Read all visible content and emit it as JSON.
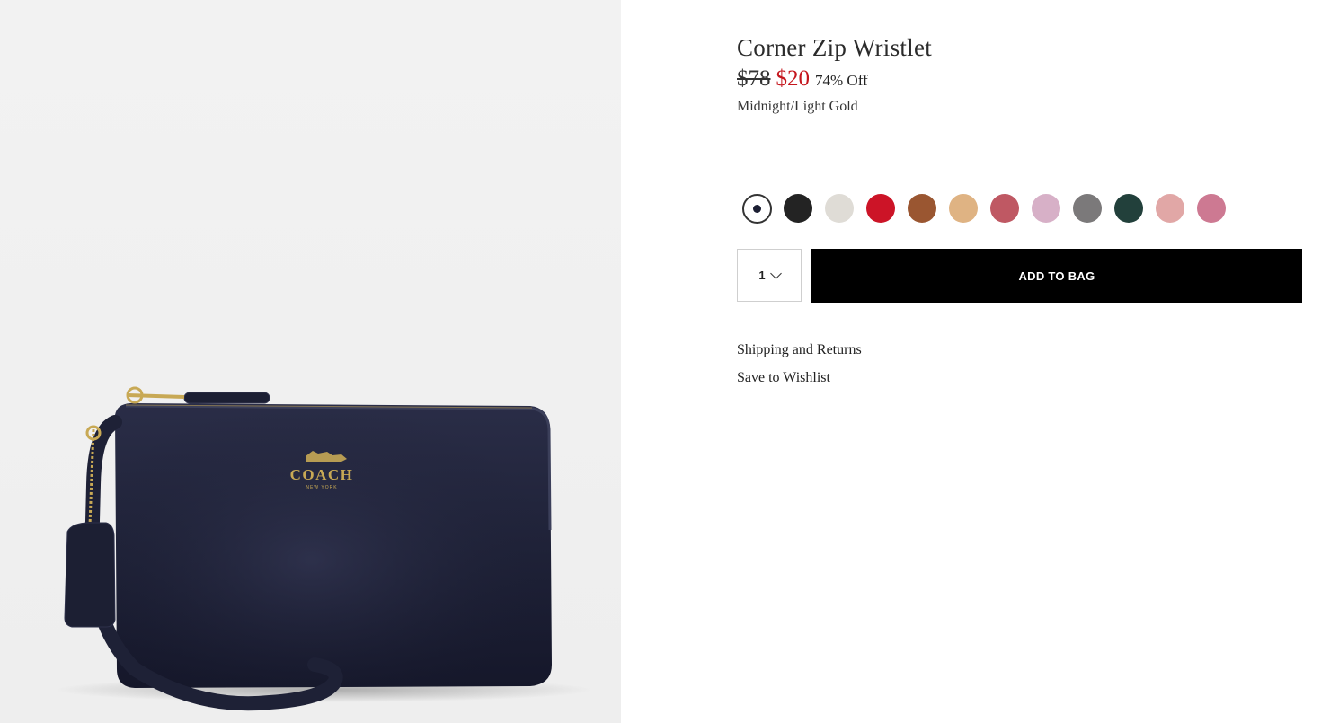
{
  "product": {
    "title": "Corner Zip Wristlet",
    "price_original": "$78",
    "price_sale": "$20",
    "discount": "74% Off",
    "color_name": "Midnight/Light Gold",
    "image": {
      "alt": "Corner Zip Wristlet",
      "logo_text": "COACH",
      "logo_subtext": "NEW YORK"
    },
    "swatches": [
      {
        "color": "#1c1f33",
        "selected": true
      },
      {
        "color": "#232323",
        "selected": false
      },
      {
        "color": "#dfdcd6",
        "selected": false
      },
      {
        "color": "#cc1427",
        "selected": false
      },
      {
        "color": "#9a5631",
        "selected": false
      },
      {
        "color": "#dfb383",
        "selected": false
      },
      {
        "color": "#bf5863",
        "selected": false
      },
      {
        "color": "#d7b0c7",
        "selected": false
      },
      {
        "color": "#7b797a",
        "selected": false
      },
      {
        "color": "#22403b",
        "selected": false
      },
      {
        "color": "#e1a7a6",
        "selected": false
      },
      {
        "color": "#cd7992",
        "selected": false
      }
    ]
  },
  "purchase": {
    "quantity": "1",
    "add_to_bag_label": "ADD TO BAG"
  },
  "links": {
    "shipping": "Shipping and Returns",
    "wishlist": "Save to Wishlist"
  }
}
